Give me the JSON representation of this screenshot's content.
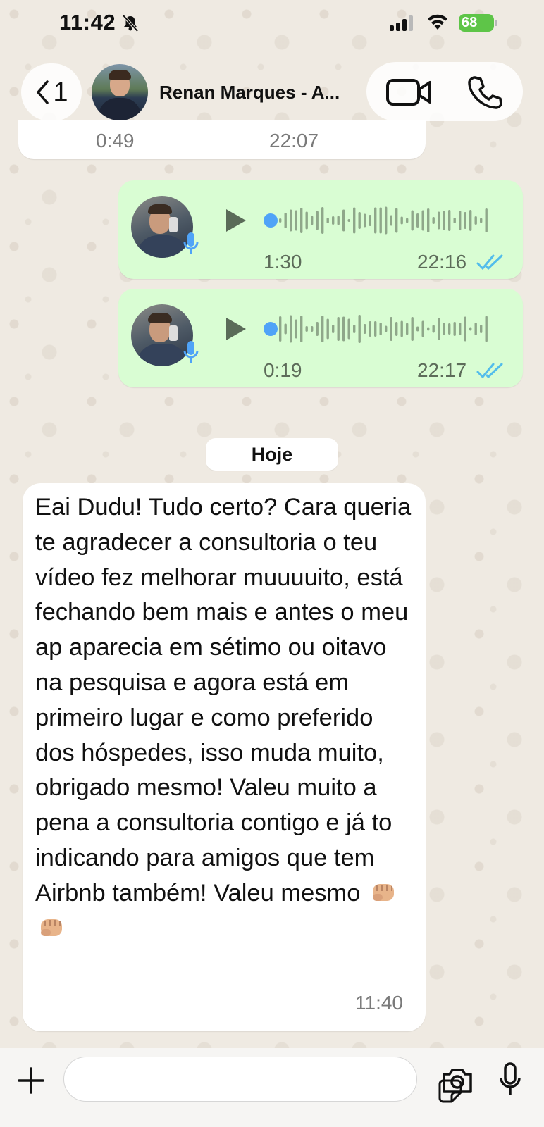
{
  "status_bar": {
    "time": "11:42",
    "battery": "68",
    "icons": [
      "bell-slash-icon",
      "signal-icon",
      "wifi-icon",
      "battery-icon"
    ]
  },
  "header": {
    "back_count": "1",
    "contact_name": "Renan Marques - A...",
    "icons": [
      "chevron-left-icon",
      "video-call-icon",
      "phone-call-icon"
    ]
  },
  "previous_message": {
    "duration": "0:49",
    "time": "22:07"
  },
  "audio_messages": [
    {
      "duration": "1:30",
      "time": "22:16",
      "progress": 0,
      "status": "read"
    },
    {
      "duration": "0:19",
      "time": "22:17",
      "progress": 0,
      "status": "read"
    }
  ],
  "date_divider": "Hoje",
  "incoming_message": {
    "text": "Eai Dudu! Tudo certo? Cara queria te agradecer a consultoria o teu vídeo fez melhorar muuuuito, está fechando bem mais e antes o meu ap aparecia em sétimo ou oitavo na pesquisa e agora está em primeiro lugar e como preferido dos hóspedes, isso muda muito, obrigado mesmo! Valeu muito a pena a consultoria contigo e já to indicando para amigos que tem Airbnb também! Valeu mesmo",
    "emoji": "👊🏼👊🏼",
    "time": "11:40"
  },
  "input_bar": {
    "placeholder": "",
    "icons": [
      "plus-icon",
      "sticker-icon",
      "camera-icon",
      "microphone-icon"
    ]
  },
  "colors": {
    "wallpaper": "#efeae2",
    "outgoing_bubble": "#d9fdd3",
    "incoming_bubble": "#ffffff",
    "read_ticks": "#53bdeb",
    "audio_dot": "#4fa3f7",
    "waveform": "#8fa78a"
  }
}
